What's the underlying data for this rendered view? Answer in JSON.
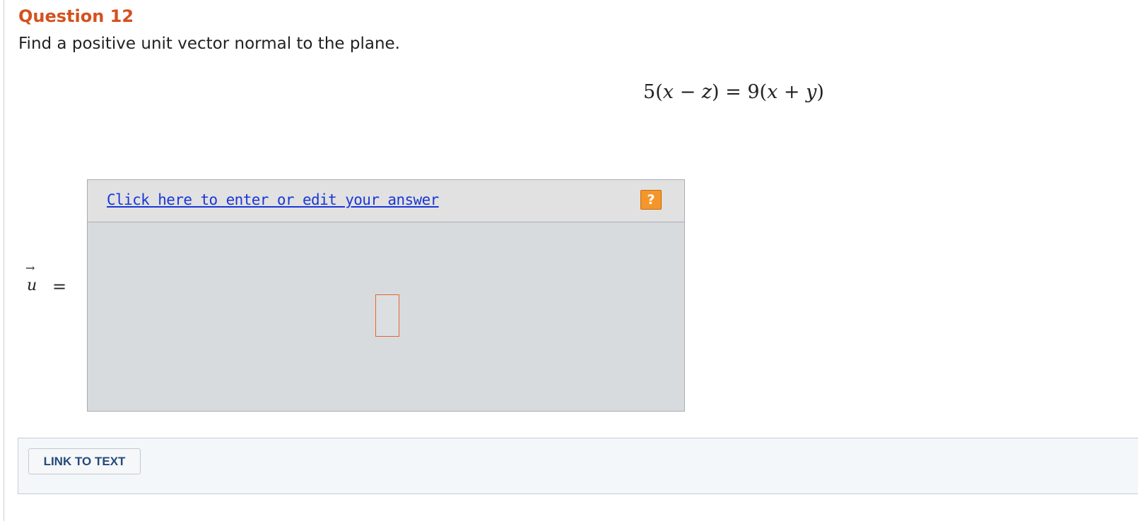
{
  "question": {
    "title": "Question 12",
    "prompt": "Find a positive unit vector normal to the plane."
  },
  "equation": {
    "lhs_coef": "5",
    "lhs_a": "x",
    "lhs_op": "−",
    "lhs_b": "z",
    "equals": "=",
    "rhs_coef": "9",
    "rhs_a": "x",
    "rhs_op": "+",
    "rhs_b": "y"
  },
  "vector_label": {
    "arrow": "→",
    "symbol": "u",
    "equals": "="
  },
  "answer": {
    "link_text": "Click here to enter or edit your answer",
    "help_symbol": "?"
  },
  "footer": {
    "link_button": "LINK TO TEXT"
  },
  "colors": {
    "title": "#d4511e",
    "link": "#1a37d6",
    "help_button": "#f4962a",
    "input_border": "#e8642c",
    "footer_button_text": "#244a7a"
  }
}
